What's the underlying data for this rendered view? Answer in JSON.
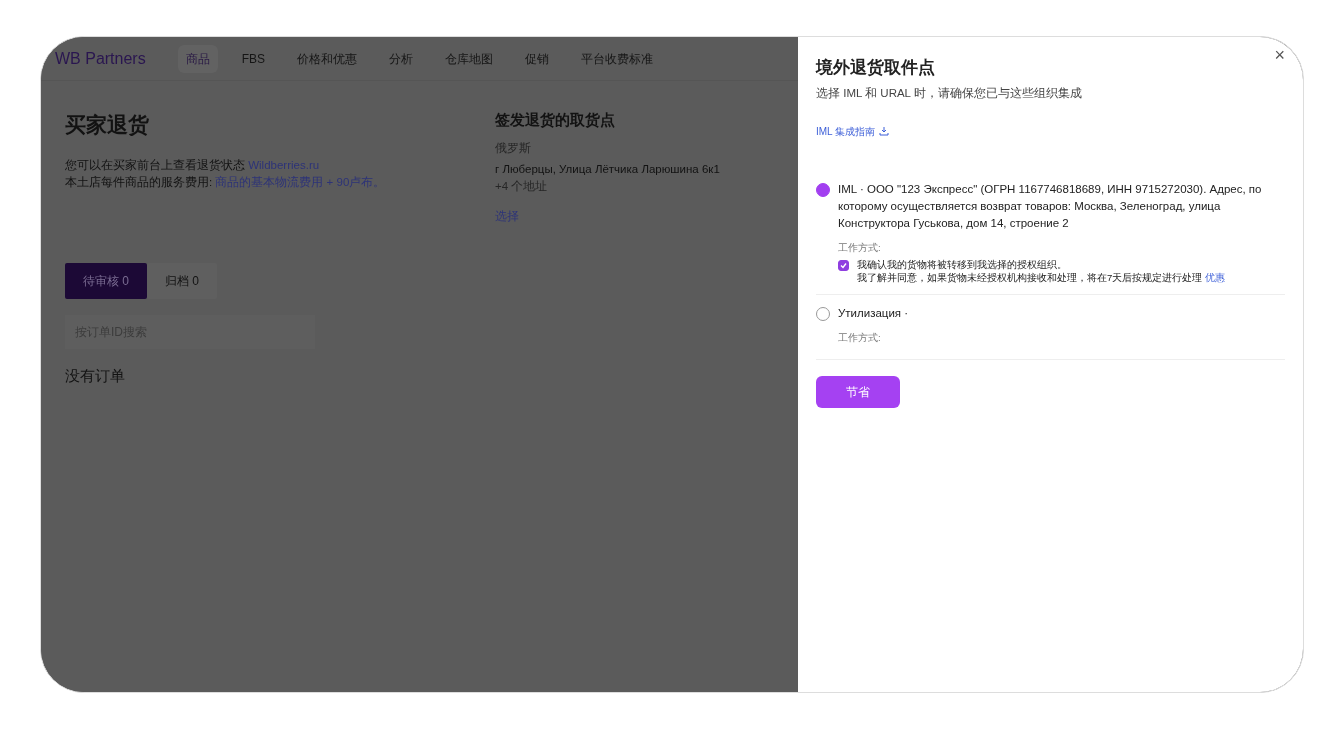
{
  "nav": {
    "logo": "WB Partners",
    "items": [
      {
        "label": "商品",
        "selected": true
      },
      {
        "label": "FBS",
        "selected": false
      },
      {
        "label": "价格和优惠",
        "selected": false
      },
      {
        "label": "分析",
        "selected": false
      },
      {
        "label": "仓库地图",
        "selected": false
      },
      {
        "label": "促销",
        "selected": false
      },
      {
        "label": "平台收费标准",
        "selected": false
      }
    ]
  },
  "returns": {
    "title": "买家退货",
    "line_1": "您可以在买家前台上查看退货状态",
    "link_1": "Wildberries.ru",
    "line_2": "本土店每件商品的服务费用:",
    "link_2": "商品的基本物流费用 + 90卢布。"
  },
  "pickup": {
    "title": "签发退货的取货点",
    "country": "俄罗斯",
    "address": "г Люберцы, Улица Лётчика Ларюшина 6к1",
    "more": "+4 个地址",
    "select_link": "选择"
  },
  "tabs": [
    {
      "label": "待审核 0",
      "selected": true
    },
    {
      "label": "归档 0",
      "selected": false
    }
  ],
  "search": {
    "placeholder": "按订单ID搜索"
  },
  "empty_text": "没有订单",
  "dialog": {
    "close": "×",
    "title": "境外退货取件点",
    "subtitle": "选择 IML 和 URAL 时，请确保您已与这些组织集成",
    "guide_link": "IML 集成指南",
    "options": [
      {
        "label": "IML · ООО \"123 Экспресс\" (ОГРН 1167746818689, ИНН 9715272030). Адрес, по которому осуществляется возврат товаров: Москва, Зеленоград, улица Конструктора Гуськова, дом 14, строение 2",
        "selected": true,
        "mode_label": "工作方式:",
        "confirm": {
          "checked": true,
          "line_1": "我确认我的货物将被转移到我选择的授权组织。",
          "line_2": "我了解并同意，如果货物未经授权机构接收和处理，将在7天后按规定进行处理",
          "link": "优惠"
        }
      },
      {
        "label": "Утилизация ·",
        "selected": false,
        "mode_label": "工作方式:"
      }
    ],
    "save_button": "节省"
  }
}
